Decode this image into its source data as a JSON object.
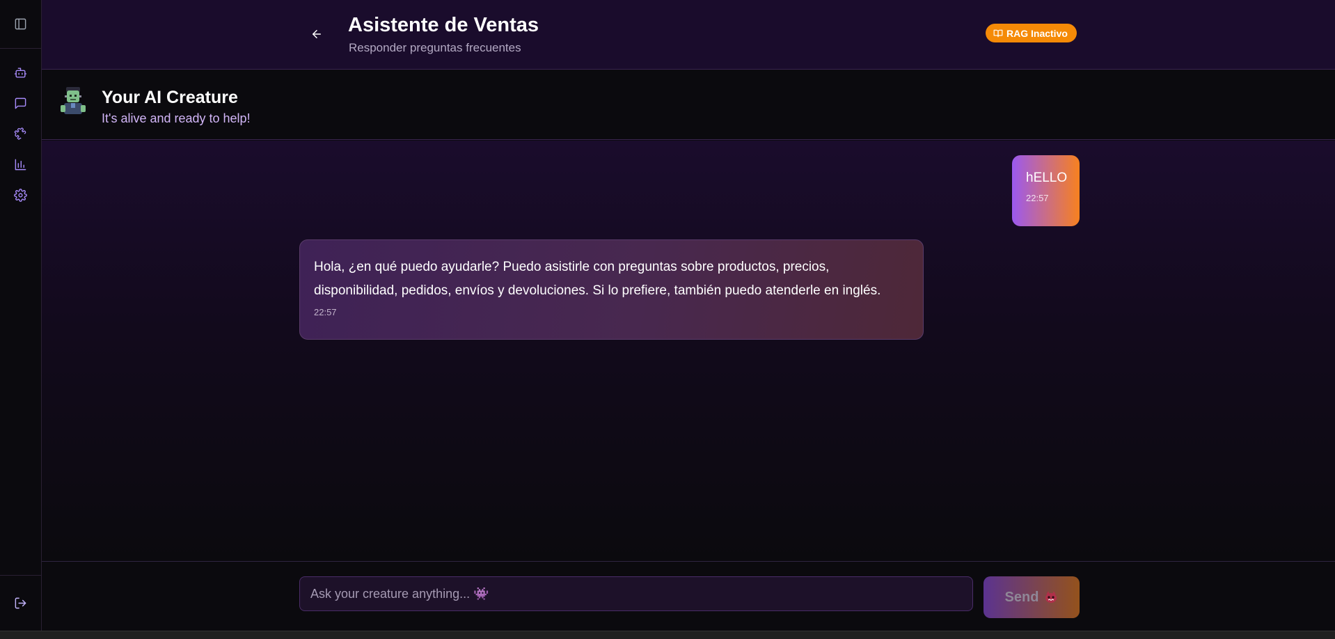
{
  "header": {
    "title": "Asistente de Ventas",
    "subtitle": "Responder preguntas frecuentes",
    "rag_badge": "RAG Inactivo"
  },
  "sidebar": {
    "toggle_icon": "sidebar-panel-icon",
    "items": [
      {
        "icon": "bot-icon",
        "name": "bots"
      },
      {
        "icon": "chat-icon",
        "name": "chat"
      },
      {
        "icon": "puzzle-icon",
        "name": "integrations"
      },
      {
        "icon": "bar-chart-icon",
        "name": "analytics"
      },
      {
        "icon": "gear-icon",
        "name": "settings"
      }
    ],
    "logout_icon": "logout-icon"
  },
  "creature": {
    "name": "Your AI Creature",
    "tagline": "It's alive and ready to help!",
    "avatar_icon": "frankenstein-emoji"
  },
  "messages": [
    {
      "role": "user",
      "text": "hELLO",
      "time": "22:57"
    },
    {
      "role": "assistant",
      "text": "Hola, ¿en qué puedo ayudarle? Puedo asistirle con preguntas sobre productos, precios, disponibilidad, pedidos, envíos y devoluciones. Si lo prefiere, también puedo atenderle en inglés.",
      "time": "22:57"
    }
  ],
  "input": {
    "placeholder": "Ask your creature anything... 👾",
    "value": ""
  },
  "send": {
    "label": "Send"
  },
  "colors": {
    "accent_purple": "#9b59f0",
    "accent_orange": "#f58a07",
    "header_bg": "#1a0c2c",
    "page_bg": "#0b0a0e"
  }
}
